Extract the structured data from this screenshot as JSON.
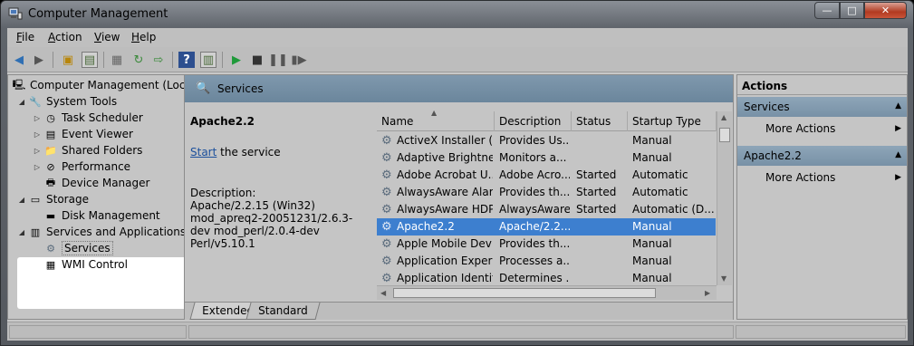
{
  "window": {
    "title": "Computer Management",
    "min": "—",
    "max": "□",
    "close": "✕"
  },
  "menu": [
    "File",
    "Action",
    "View",
    "Help"
  ],
  "toolbar": {
    "icons": [
      "back-icon",
      "forward-icon",
      "up-folder-icon",
      "show-hide-tree-icon",
      "properties-icon",
      "refresh-icon",
      "export-icon",
      "help-icon",
      "show-hide-action-icon",
      "start-service-icon",
      "stop-service-icon",
      "pause-service-icon",
      "restart-service-icon"
    ]
  },
  "tree": {
    "root": "Computer Management (Local",
    "system_tools": "System Tools",
    "task_scheduler": "Task Scheduler",
    "event_viewer": "Event Viewer",
    "shared_folders": "Shared Folders",
    "performance": "Performance",
    "device_manager": "Device Manager",
    "storage": "Storage",
    "disk_management": "Disk Management",
    "services_apps": "Services and Applications",
    "services": "Services",
    "wmi": "WMI Control"
  },
  "middle": {
    "header": "Services",
    "selected_name": "Apache2.2",
    "start_link": "Start",
    "start_rest": " the service",
    "desc_label": "Description:",
    "desc_text": "Apache/2.2.15 (Win32) mod_apreq2-20051231/2.6.3-dev mod_perl/2.0.4-dev Perl/v5.10.1"
  },
  "columns": [
    "Name",
    "Description",
    "Status",
    "Startup Type"
  ],
  "rows": [
    {
      "name": "ActiveX Installer (...",
      "desc": "Provides Us...",
      "status": "",
      "startup": "Manual"
    },
    {
      "name": "Adaptive Brightness",
      "desc": "Monitors a...",
      "status": "",
      "startup": "Manual"
    },
    {
      "name": "Adobe Acrobat U...",
      "desc": "Adobe Acro...",
      "status": "Started",
      "startup": "Automatic"
    },
    {
      "name": "AlwaysAware Alar...",
      "desc": "Provides th...",
      "status": "Started",
      "startup": "Automatic"
    },
    {
      "name": "AlwaysAware HDP...",
      "desc": "AlwaysAware...",
      "status": "Started",
      "startup": "Automatic (D..."
    },
    {
      "name": "Apache2.2",
      "desc": "Apache/2.2....",
      "status": "",
      "startup": "Manual"
    },
    {
      "name": "Apple Mobile Devi...",
      "desc": "Provides th...",
      "status": "",
      "startup": "Manual"
    },
    {
      "name": "Application Experi...",
      "desc": "Processes a...",
      "status": "",
      "startup": "Manual"
    },
    {
      "name": "Application Identity",
      "desc": "Determines ...",
      "status": "",
      "startup": "Manual"
    }
  ],
  "tabs": [
    "Extended",
    "Standard"
  ],
  "actions": {
    "title": "Actions",
    "group1": "Services",
    "group1_item": "More Actions",
    "group2": "Apache2.2",
    "group2_item": "More Actions"
  },
  "colors": {
    "selection": "#3d7fcf",
    "panel_header": "#7891a6"
  }
}
